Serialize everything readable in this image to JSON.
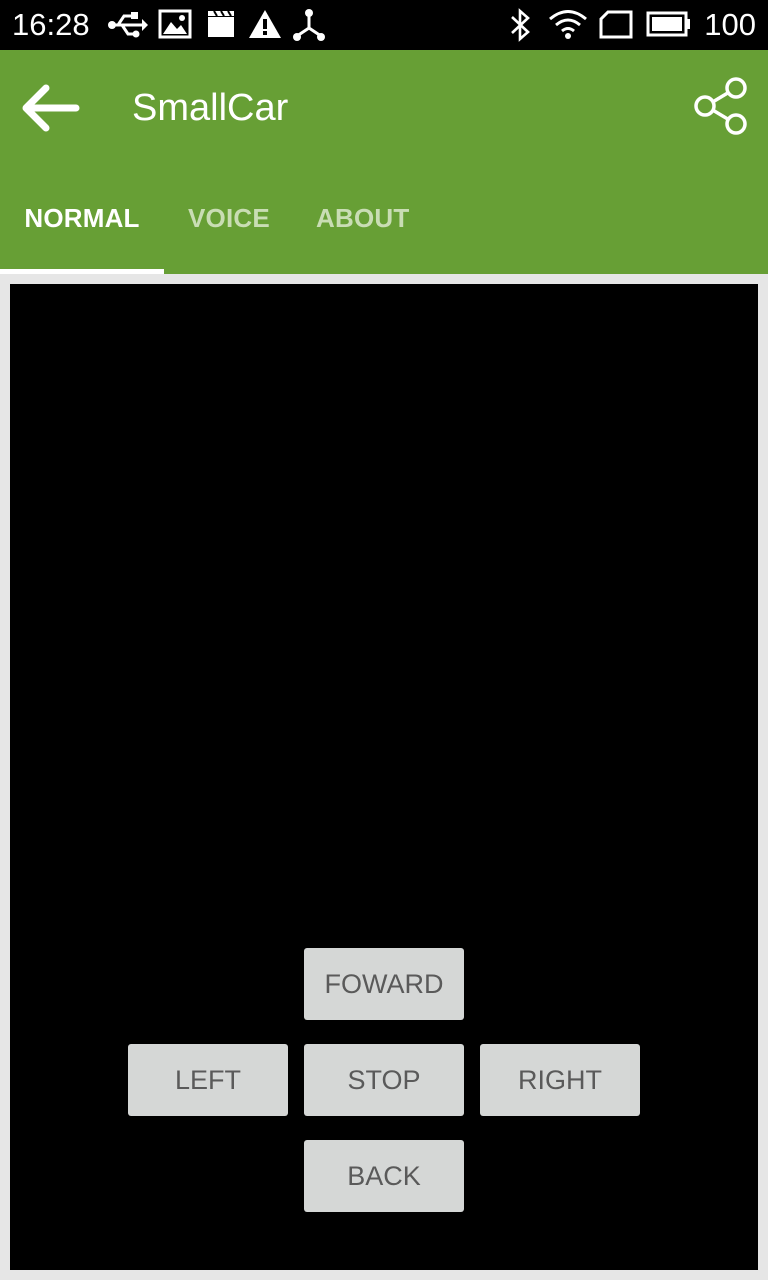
{
  "status_bar": {
    "time": "16:28",
    "battery_percent": "100",
    "left_icons": [
      "usb-icon",
      "image-icon",
      "clapper-icon",
      "warning-icon",
      "share-nodes-icon"
    ],
    "right_icons": [
      "bluetooth-icon",
      "wifi-icon",
      "sim-icon",
      "battery-icon"
    ]
  },
  "app_bar": {
    "title": "SmallCar",
    "color": "#679f35",
    "back_icon": "arrow-back-icon",
    "share_icon": "share-icon"
  },
  "tabs": [
    {
      "label": "NORMAL",
      "selected": true
    },
    {
      "label": "VOICE",
      "selected": false
    },
    {
      "label": "ABOUT",
      "selected": false
    }
  ],
  "controls": {
    "forward": "FOWARD",
    "left": "LEFT",
    "stop": "STOP",
    "right": "RIGHT",
    "back": "BACK"
  }
}
